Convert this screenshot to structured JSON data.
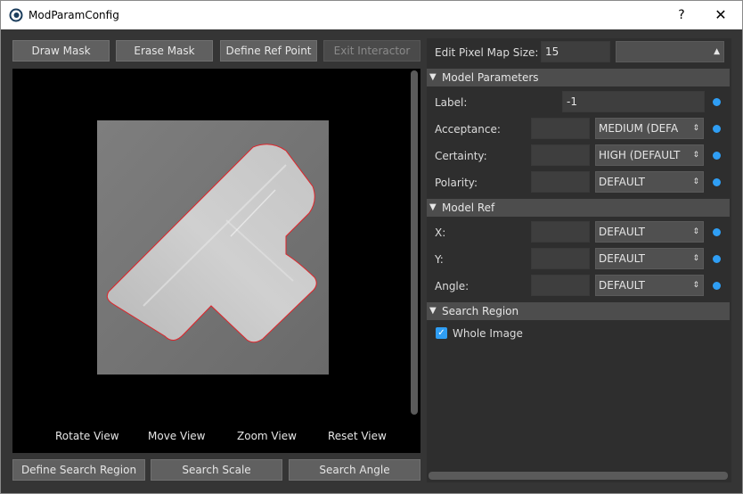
{
  "window": {
    "title": "ModParamConfig",
    "help_label": "?",
    "close_label": "✕",
    "app_icon": "eye-icon"
  },
  "toolbar": {
    "draw_mask": "Draw Mask",
    "erase_mask": "Erase Mask",
    "define_ref_point": "Define Ref Point",
    "exit_interactor": "Exit Interactor"
  },
  "viewer": {
    "rotate_view": "Rotate View",
    "move_view": "Move View",
    "zoom_view": "Zoom View",
    "reset_view": "Reset View"
  },
  "bottom_buttons": {
    "define_search_region": "Define Search Region",
    "search_scale": "Search Scale",
    "search_angle": "Search Angle"
  },
  "right_panel": {
    "pixel_map_label": "Edit Pixel Map Size:",
    "pixel_map_value": "15",
    "pixel_map_combo": "",
    "sections": {
      "model_parameters": "Model Parameters",
      "model_ref": "Model Ref",
      "search_region": "Search Region"
    },
    "label": {
      "name": "Label:",
      "value": "-1"
    },
    "acceptance": {
      "name": "Acceptance:",
      "value": "",
      "combo": "MEDIUM (DEFA"
    },
    "certainty": {
      "name": "Certainty:",
      "value": "",
      "combo": "HIGH (DEFAULT"
    },
    "polarity": {
      "name": "Polarity:",
      "value": "",
      "combo": "DEFAULT"
    },
    "x": {
      "name": "X:",
      "value": "",
      "combo": "DEFAULT"
    },
    "y": {
      "name": "Y:",
      "value": "",
      "combo": "DEFAULT"
    },
    "angle": {
      "name": "Angle:",
      "value": "",
      "combo": "DEFAULT"
    },
    "whole_image": {
      "label": "Whole Image",
      "checked": true
    }
  },
  "colors": {
    "accent": "#2f9ef4",
    "background": "#353535",
    "outline": "#e0242a"
  }
}
